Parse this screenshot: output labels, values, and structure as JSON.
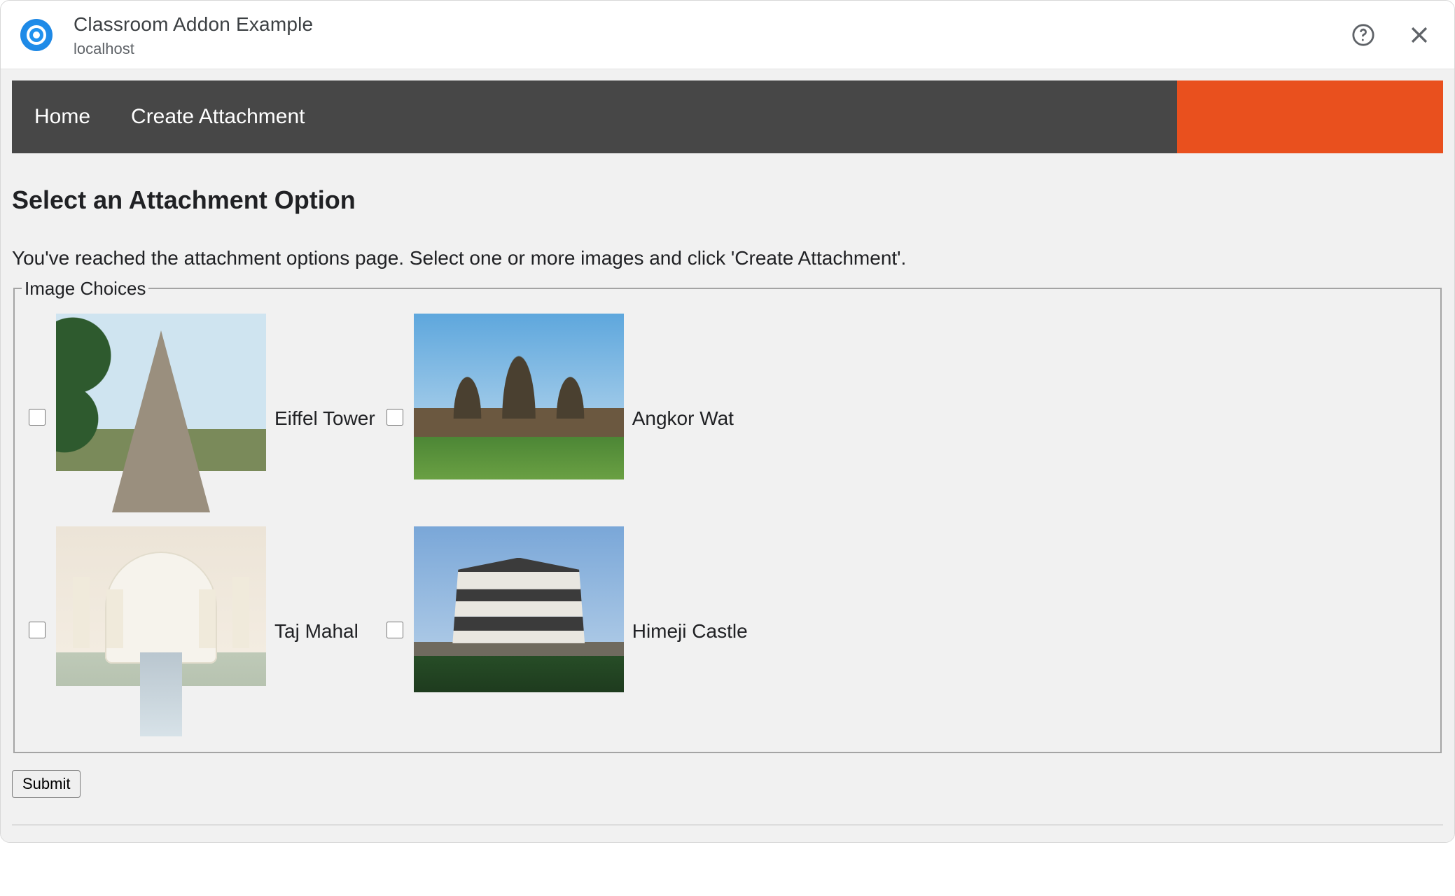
{
  "dialog": {
    "title": "Classroom Addon Example",
    "subtitle": "localhost",
    "help_icon": "help-circle-icon",
    "close_icon": "close-icon"
  },
  "nav": {
    "items": [
      {
        "label": "Home"
      },
      {
        "label": "Create Attachment"
      }
    ],
    "accent_color": "#e9501e"
  },
  "page": {
    "title": "Select an Attachment Option",
    "description": "You've reached the attachment options page. Select one or more images and click 'Create Attachment'.",
    "fieldset_legend": "Image Choices",
    "submit_label": "Submit"
  },
  "images": [
    {
      "label": "Eiffel Tower",
      "key": "eiffel",
      "checked": false
    },
    {
      "label": "Angkor Wat",
      "key": "angkor",
      "checked": false
    },
    {
      "label": "Taj Mahal",
      "key": "taj",
      "checked": false
    },
    {
      "label": "Himeji Castle",
      "key": "himeji",
      "checked": false
    }
  ]
}
